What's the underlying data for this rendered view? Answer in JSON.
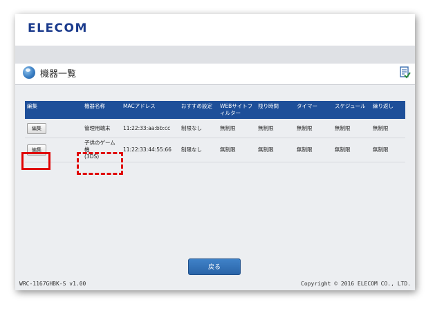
{
  "header": {
    "logo": "ELECOM"
  },
  "page": {
    "title": "機器一覧"
  },
  "table": {
    "columns": [
      "編集",
      "機器名称",
      "MACアドレス",
      "おすすめ設定",
      "WEBサイトフィルター",
      "残り時間",
      "タイマー",
      "スケジュール",
      "繰り返し"
    ],
    "rows": [
      {
        "edit_label": "編集",
        "name": "管理用端末",
        "mac": "11:22:33:aa:bb:cc",
        "recommended": "制限なし",
        "web_filter": "無制限",
        "remaining": "無制限",
        "timer": "無制限",
        "schedule": "無制限",
        "repeat": "無制限"
      },
      {
        "edit_label": "編集",
        "name": "子供のゲーム機",
        "name_sub": "(3DS)",
        "mac": "11:22:33:44:55:66",
        "recommended": "制限なし",
        "web_filter": "無制限",
        "remaining": "無制限",
        "timer": "無制限",
        "schedule": "無制限",
        "repeat": "無制限"
      }
    ]
  },
  "actions": {
    "back_label": "戻る"
  },
  "footer": {
    "model": "WRC-1167GHBK-S v1.00",
    "copyright": "Copyright © 2016 ELECOM CO., LTD."
  },
  "icons": [
    "globe-icon",
    "checklist-icon"
  ],
  "colors": {
    "header_blue": "#1e4f99",
    "highlight_red": "#e00000",
    "logo_blue": "#1a3a8c"
  }
}
